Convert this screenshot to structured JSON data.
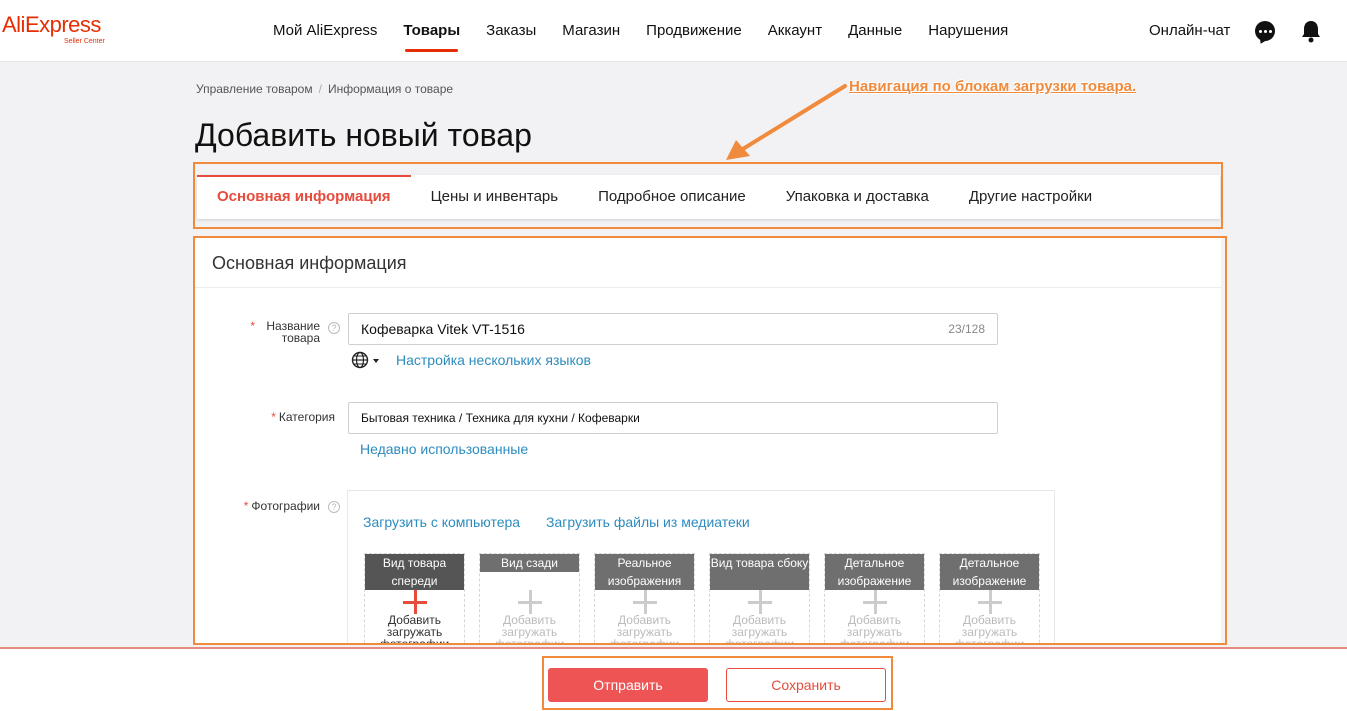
{
  "header": {
    "logo_main": "AliExpress",
    "logo_sub": "Seller Center",
    "nav": [
      {
        "label": "Мой AliExpress",
        "active": false
      },
      {
        "label": "Товары",
        "active": true
      },
      {
        "label": "Заказы",
        "active": false
      },
      {
        "label": "Магазин",
        "active": false
      },
      {
        "label": "Продвижение",
        "active": false
      },
      {
        "label": "Аккаунт",
        "active": false
      },
      {
        "label": "Данные",
        "active": false
      },
      {
        "label": "Нарушения",
        "active": false
      }
    ],
    "chat_label": "Онлайн-чат",
    "accent_color": "#e62e04"
  },
  "breadcrumb": [
    "Управление товаром",
    "Информация о товаре"
  ],
  "breadcrumb_sep": "/",
  "page_title": "Добавить новый товар",
  "annotation": "Навигация по блокам загрузки товара.",
  "tabs": [
    {
      "label": "Основная информация",
      "active": true
    },
    {
      "label": "Цены и инвентарь",
      "active": false
    },
    {
      "label": "Подробное описание",
      "active": false
    },
    {
      "label": "Упаковка и доставка",
      "active": false
    },
    {
      "label": "Другие настройки",
      "active": false
    }
  ],
  "section": {
    "title": "Основная информация",
    "name_field": {
      "required": "*",
      "label": "Название товара",
      "value": "Кофеварка Vitek VT-1516",
      "counter": "23/128",
      "help": "?"
    },
    "languages_link": "Настройка нескольких языков",
    "category_field": {
      "required": "*",
      "label": "Категория",
      "value": "Бытовая техника / Техника для кухни / Кофеварки"
    },
    "recent_link": "Недавно использованные",
    "photos_field": {
      "required": "*",
      "label": "Фотографии",
      "help": "?",
      "upload_computer": "Загрузить с компьютера",
      "upload_media": "Загрузить файлы из медиатеки",
      "slots": [
        {
          "title": "Вид товара спереди",
          "text": "Добавить загружать фотографии"
        },
        {
          "title": "Вид сзади",
          "text": "Добавить загружать фотографии"
        },
        {
          "title": "Реальное изображения",
          "text": "Добавить загружать фотографии"
        },
        {
          "title": "Вид товара сбоку",
          "text": "Добавить загружать фотографии"
        },
        {
          "title": "Детальное изображение",
          "text": "Добавить загружать фотографии"
        },
        {
          "title": "Детальное изображение",
          "text": "Добавить загружать фотографии"
        }
      ]
    }
  },
  "footer": {
    "submit_label": "Отправить",
    "save_label": "Сохранить"
  },
  "colors": {
    "primary_red": "#ee5454",
    "annotation_orange": "#f08a3c",
    "link_blue": "#2d8cbe"
  }
}
